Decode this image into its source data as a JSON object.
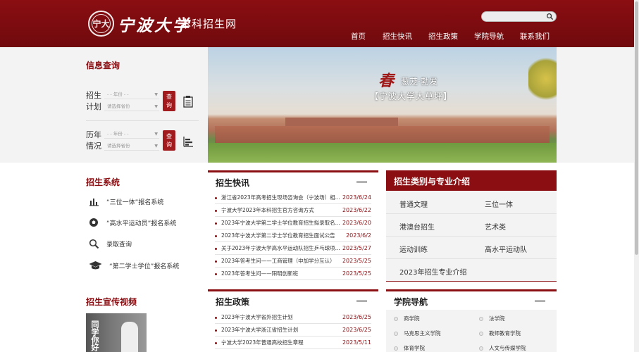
{
  "header": {
    "seal_text": "宁大",
    "logo_calligraphy": "宁波大学",
    "logo_subtitle": "本科招生网",
    "search": {
      "placeholder": "",
      "icon": "search-icon"
    },
    "nav": [
      "首页",
      "招生快讯",
      "招生政策",
      "学院导航",
      "联系我们"
    ],
    "brand_color": "#8a0e12"
  },
  "query": {
    "title": "信息查询",
    "plan": {
      "label_top": "招生",
      "label_bottom": "计划",
      "year_select": "- - 年份 - -",
      "province_select": "请选择省份",
      "button_top": "查",
      "button_bottom": "询",
      "icon": "clipboard-icon"
    },
    "history": {
      "label_top": "历年",
      "label_bottom": "情况",
      "year_select": "- - 年份 - -",
      "province_select": "请选择省份",
      "button_top": "查",
      "button_bottom": "询",
      "icon": "bar-chart-icon"
    }
  },
  "banner": {
    "chun": "春",
    "line1": "葱茏·勃发",
    "line2": "【宁波大学大草坪】"
  },
  "systems": {
    "title": "招生系统",
    "items": [
      {
        "label": "“三位一体”报名系统",
        "icon": "bar-chart-icon"
      },
      {
        "label": "“高水平运动员”报名系统",
        "icon": "football-icon"
      },
      {
        "label": "录取查询",
        "icon": "search-icon"
      },
      {
        "label": "“第二学士学位”报名系统",
        "icon": "graduation-cap-icon"
      }
    ]
  },
  "video": {
    "title": "招生宣传视频",
    "thumb_text": "同学你好"
  },
  "news": {
    "title": "招生快讯",
    "items": [
      {
        "title": "浙江省2023年高考招生现场咨询会（宁波场）相...",
        "date": "2023/6/24"
      },
      {
        "title": "宁波大学2023年本科招生官方咨询方式",
        "date": "2023/6/22"
      },
      {
        "title": "2023年宁波大学第二学士学位教育招生拟录取名...",
        "date": "2023/6/20"
      },
      {
        "title": "2023年宁波大学第二学士学位教育招生面试公告",
        "date": "2023/6/2"
      },
      {
        "title": "关于2023年宁波大学高水平运动队招生乒乓球项...",
        "date": "2023/5/27"
      },
      {
        "title": "2023年答考生问——工商管理（中加学分互认）",
        "date": "2023/5/25"
      },
      {
        "title": "2023年答考生问——阳明创新班",
        "date": "2023/5/25"
      }
    ]
  },
  "policy": {
    "title": "招生政策",
    "items": [
      {
        "title": "2023年宁波大学省外招生计划",
        "date": "2023/6/25"
      },
      {
        "title": "2023年宁波大学浙江省招生计划",
        "date": "2023/6/25"
      },
      {
        "title": "宁波大学2023年普通高校招生章程",
        "date": "2023/5/11"
      }
    ]
  },
  "categories": {
    "title": "招生类别与专业介绍",
    "items": [
      "普通文理",
      "三位一体",
      "港澳台招生",
      "艺术类",
      "运动训练",
      "高水平运动队",
      "2023年招生专业介绍"
    ]
  },
  "departments": {
    "title": "学院导航",
    "items": [
      "商学院",
      "法学院",
      "马克思主义学院",
      "教师教育学院",
      "体育学院",
      "人文与传媒学院"
    ]
  }
}
